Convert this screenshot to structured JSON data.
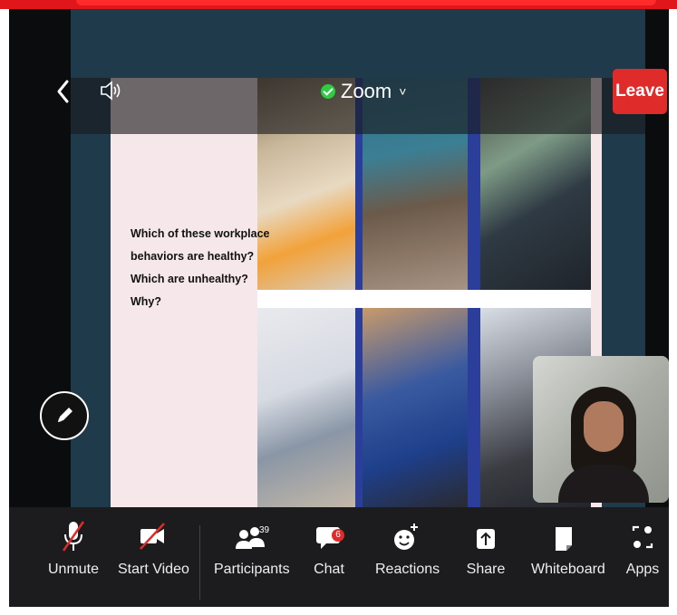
{
  "header": {
    "back_icon": "chevron-left-icon",
    "speaker_icon": "speaker-icon",
    "title": "Zoom",
    "title_chevron": "˅",
    "leave_label": "Leave"
  },
  "slide": {
    "text_lines": [
      "Which of these workplace",
      "behaviors are healthy?",
      "Which are unhealthy?",
      "Why?"
    ]
  },
  "toolbar": {
    "items": [
      {
        "label": "Unmute",
        "icon": "microphone-muted-icon"
      },
      {
        "label": "Start Video",
        "icon": "video-off-icon"
      },
      {
        "label": "Participants",
        "icon": "participants-icon",
        "count": "39"
      },
      {
        "label": "Chat",
        "icon": "chat-icon",
        "badge": "6"
      },
      {
        "label": "Reactions",
        "icon": "reactions-icon"
      },
      {
        "label": "Share",
        "icon": "share-icon"
      },
      {
        "label": "Whiteboard",
        "icon": "whiteboard-icon"
      },
      {
        "label": "Apps",
        "icon": "apps-icon"
      }
    ]
  },
  "colors": {
    "leave": "#e02b2b",
    "toolbar_bg": "#1c1c1e",
    "share_bg": "#1f3a4a",
    "slide_bg": "#f6e8ea",
    "secure_green": "#2ecc40"
  }
}
